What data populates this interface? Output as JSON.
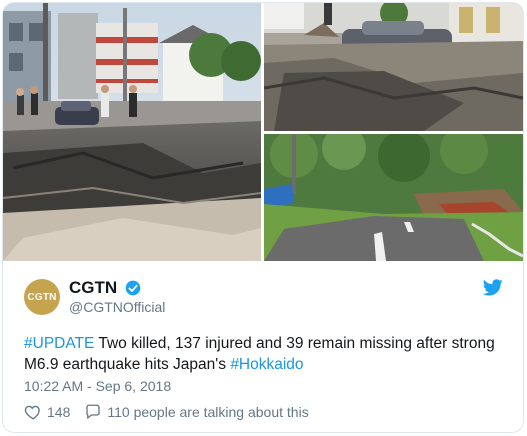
{
  "media": {
    "main_image": "earthquake road collapse with cracked asphalt and onlookers",
    "top_right_image": "buckled street with car partially sunk in mud",
    "bottom_right_image": "curving road with collapsed roadside slope"
  },
  "tweet": {
    "display_name": "CGTN",
    "handle": "@CGTNOfficial",
    "avatar_text": "CGTN",
    "hashtag_update": "#UPDATE",
    "text_main": " Two killed, 137 injured and 39 remain missing after strong M6.9 earthquake hits Japan's ",
    "hashtag_hokkaido": "#Hokkaido",
    "timestamp": "10:22 AM - Sep 6, 2018",
    "likes": "148",
    "talking": "110 people are talking about this"
  },
  "icons": {
    "verified": "verified-badge-icon",
    "bird": "twitter-bird-icon",
    "like": "heart-icon",
    "reply": "speech-bubble-icon"
  },
  "colors": {
    "link": "#1b95e0",
    "verified": "#1da1f2",
    "avatar_bg": "#c6a44f",
    "muted": "#657786"
  }
}
